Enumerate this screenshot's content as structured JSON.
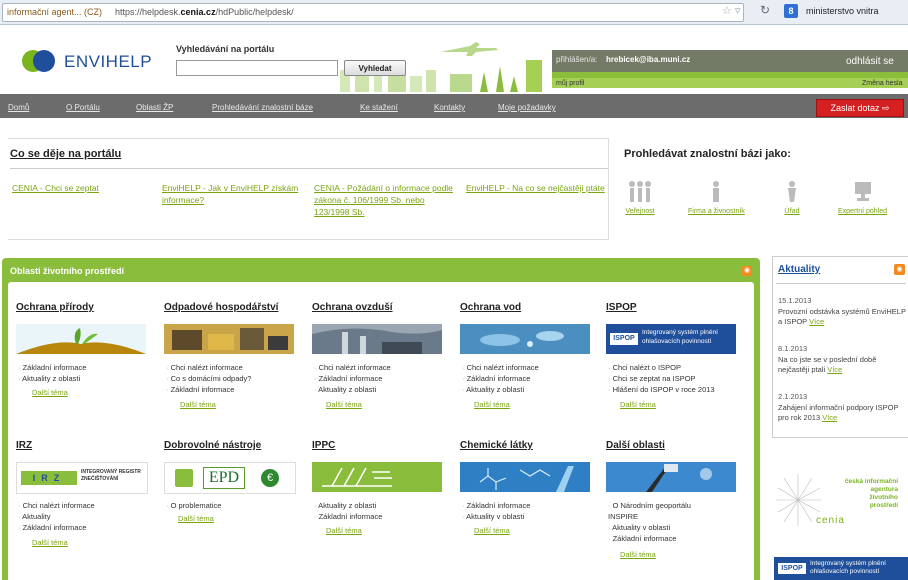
{
  "browser": {
    "tab_title": "informační agent... (CZ)",
    "url_prefix": "https://helpdesk.",
    "url_domain": "cenia.cz",
    "url_path": "/hdPublic/helpdesk/",
    "search_text": "ministerstvo vnitra"
  },
  "header": {
    "brand": "ENVIHELP",
    "search_label": "Vyhledávání na portálu",
    "search_button": "Vyhledat",
    "user_label": "přihlášen/a:",
    "user_email": "hrebicek@iba.muni.cz",
    "logout": "odhlásit se",
    "my_profile": "můj profil",
    "change_password": "Změna hesla"
  },
  "nav": {
    "items": [
      "Domů",
      "O Portálu",
      "Oblasti ŽP",
      "Prohledávání znalostní báze",
      "Ke stažení",
      "Kontakty",
      "Moje požadavky"
    ],
    "ask_button": "Zaslat dotaz"
  },
  "news_section": {
    "heading": "Co se děje na portálu",
    "links": [
      "CENIA - Chci se zeptat",
      "EnviHELP - Jak v EnviHELP získám informace?",
      "CENIA - Požádání o informace podle zákona č. 106/1999 Sb. nebo 123/1998 Sb.",
      "EnviHELP - Na co se nejčastěji ptáte"
    ]
  },
  "browse_as": {
    "heading": "Prohledávat znalostní bázi jako:",
    "roles": [
      "Veřejnost",
      "Firma a živnostník",
      "Úřad",
      "Expertní pohled"
    ]
  },
  "areas": {
    "title": "Oblasti životního prostředí",
    "items": [
      {
        "title": "Ochrana přírody",
        "links": [
          "Základní informace",
          "Aktuality z oblasti"
        ],
        "more": "Další téma"
      },
      {
        "title": "Odpadové hospodářství",
        "links": [
          "Chci nalézt informace",
          "Co s domácími odpady?",
          "Základní informace"
        ],
        "more": "Další téma"
      },
      {
        "title": "Ochrana ovzduší",
        "links": [
          "Chci nalézt informace",
          "Základní informace",
          "Aktuality z oblasti"
        ],
        "more": "Další téma"
      },
      {
        "title": "Ochrana vod",
        "links": [
          "Chci nalézt informace",
          "Základní informace",
          "Aktuality z oblasti"
        ],
        "more": "Další téma"
      },
      {
        "title": "ISPOP",
        "links": [
          "Chci nalézt o ISPOP",
          "Chci se zeptat na ISPOP",
          "Hlášení do ISPOP v roce 2013"
        ],
        "more": "Další téma",
        "banner": "Integrovaný systém plnění ohlašovacích povinností",
        "tag": "ISPOP"
      },
      {
        "title": "IRZ",
        "links": [
          "Chci nalézt informace",
          "Aktuality",
          "Základní informace"
        ],
        "more": "Další téma",
        "banner": "INTEGROVANÝ REGISTR ZNEČIŠŤOVÁNÍ",
        "tag": "IRZ"
      },
      {
        "title": "Dobrovolné nástroje",
        "links": [
          "O problematice"
        ],
        "more": "Další téma",
        "tag": "EPD"
      },
      {
        "title": "IPPC",
        "links": [
          "Aktuality z oblasti",
          "Základní informace"
        ],
        "more": "Další téma"
      },
      {
        "title": "Chemické látky",
        "links": [
          "Základní informace",
          "Aktuality v oblasti"
        ],
        "more": "Další téma"
      },
      {
        "title": "Další oblasti",
        "links": [
          "O Národním geoportálu INSPIRE",
          "Aktuality v oblasti",
          "Základní informace"
        ],
        "more": "Další téma"
      }
    ]
  },
  "aktuality": {
    "title": "Aktuality",
    "items": [
      {
        "date": "15.1.2013",
        "text": "Provozní odstávka systémů EnviHELP a ISPOP",
        "more": "Více"
      },
      {
        "date": "8.1.2013",
        "text": "Na co jste se v poslední době nejčastěji ptali",
        "more": "Více"
      },
      {
        "date": "2.1.2013",
        "text": "Zahájení informační podpory ISPOP pro rok 2013",
        "more": "Více"
      }
    ]
  },
  "cenia": {
    "text": "česká informační agentura životního prostředí",
    "name": "cenia"
  },
  "ispop_banner": {
    "tag": "ISPOP",
    "text": "Integrovaný systém plnění ohlašovacích povinností"
  },
  "colors": {
    "accent_green": "#8bbd3c",
    "brand_blue": "#1f4f9a",
    "nav_gray": "#6c6c6c",
    "ask_red": "#d42020"
  }
}
